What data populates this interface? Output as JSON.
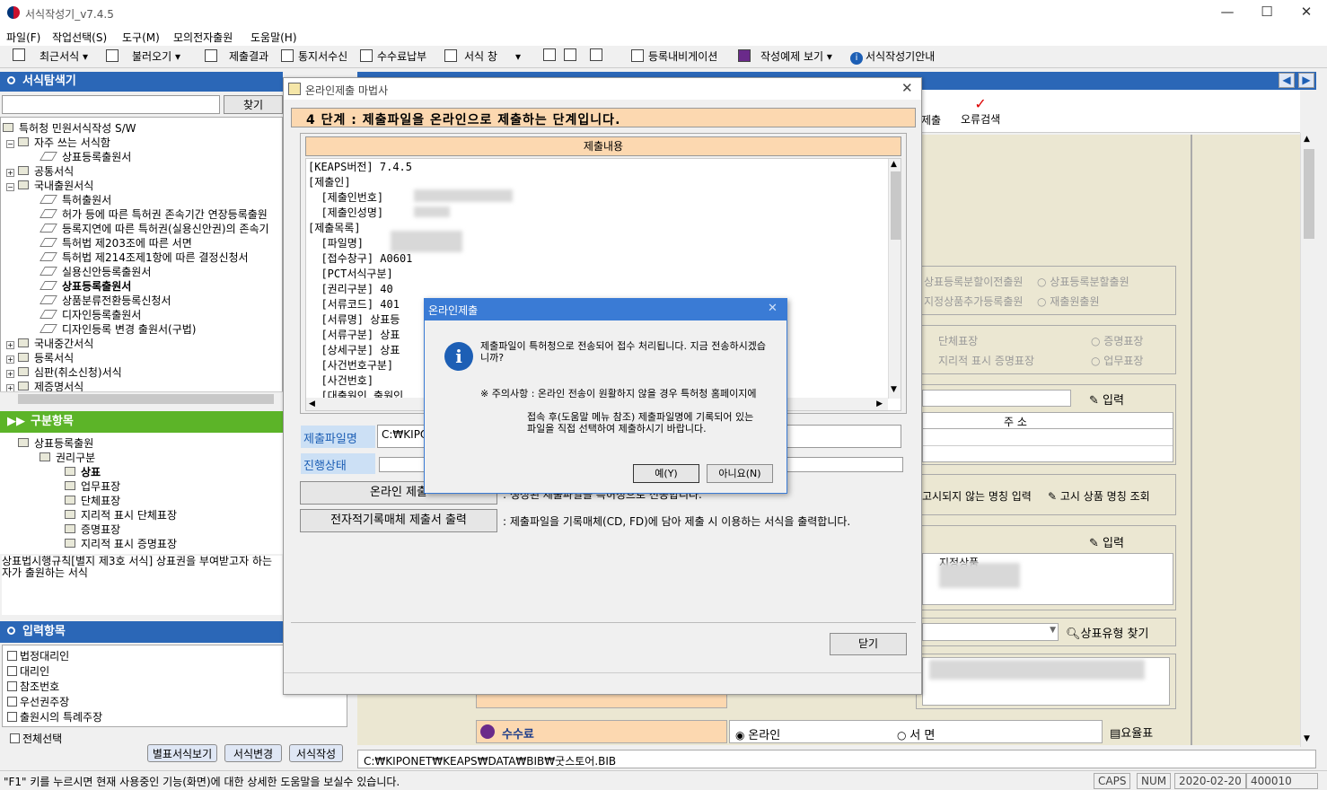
{
  "app": {
    "title": "서식작성기_v7.4.5"
  },
  "menu": [
    "파일(F)",
    "작업선택(S)",
    "도구(M)",
    "모의전자출원",
    "도움말(H)"
  ],
  "toolbar": {
    "recent": "최근서식",
    "load": "불러오기",
    "result": "제출결과",
    "notice": "통지서수신",
    "fee": "수수료납부",
    "window": "서식 창",
    "navigation": "등록내비게이션",
    "example": "작성예제 보기",
    "guide": "서식작성기안내"
  },
  "explorer": {
    "header": "서식탐색기",
    "find_button": "찾기",
    "tree": [
      {
        "label": "특허청 민원서식작성 S/W",
        "level": 0
      },
      {
        "label": "자주 쓰는 서식함",
        "level": 1
      },
      {
        "label": "상표등록출원서",
        "level": 2
      },
      {
        "label": "공통서식",
        "level": 1
      },
      {
        "label": "국내출원서식",
        "level": 1
      },
      {
        "label": "특허출원서",
        "level": 2
      },
      {
        "label": "허가 등에 따른 특허권 존속기간 연장등록출원",
        "level": 2
      },
      {
        "label": "등록지연에 따른 특허권(실용신안권)의 존속기",
        "level": 2
      },
      {
        "label": "특허법 제203조에 따른 서면",
        "level": 2
      },
      {
        "label": "특허법 제214조제1항에 따른 결정신청서",
        "level": 2
      },
      {
        "label": "실용신안등록출원서",
        "level": 2
      },
      {
        "label": "상표등록출원서",
        "level": 2,
        "bold": true
      },
      {
        "label": "상품분류전환등록신청서",
        "level": 2
      },
      {
        "label": "디자인등록출원서",
        "level": 2
      },
      {
        "label": "디자인등록 변경 출원서(구법)",
        "level": 2
      },
      {
        "label": "국내중간서식",
        "level": 1
      },
      {
        "label": "등록서식",
        "level": 1
      },
      {
        "label": "심판(취소신청)서식",
        "level": 1
      },
      {
        "label": "제증명서식",
        "level": 1
      }
    ]
  },
  "category": {
    "header": "구분항목",
    "root": "상표등록출원",
    "sub": "권리구분",
    "items": [
      "상표",
      "업무표장",
      "단체표장",
      "지리적 표시 단체표장",
      "증명표장",
      "지리적 표시 증명표장"
    ],
    "description": "상표법시행규칙[별지 제3호 서식] 상표권을 부여받고자 하는 자가 출원하는 서식"
  },
  "input_items": {
    "header": "입력항목",
    "items": [
      "법정대리인",
      "대리인",
      "참조번호",
      "우선권주장",
      "출원시의 특례주장"
    ],
    "select_all": "전체선택",
    "btn_separate": "별표서식보기",
    "btn_change": "서식변경",
    "btn_write": "서식작성"
  },
  "right": {
    "submit_tab": "제출",
    "error_check": "오류검색",
    "opt1": "상표등록분할이전출원",
    "opt1a": "상표등록분할출원",
    "opt2": "지정상품추가등록출원",
    "opt2a": "재출원출원",
    "opt3": "단체표장",
    "opt3a": "증명표장",
    "opt4": "지리적 표시 증명표장",
    "opt4a": "업무표장",
    "input": "입력",
    "address": "주    소",
    "unlisted": "고시되지 않는 명칭 입력",
    "lookup": "고시 상품 명칭 조회",
    "input2": "입력",
    "designated": "지정상품",
    "type_search": "상표유형 찾기",
    "fee": "수수료",
    "online": "온라인",
    "paper": "서   면",
    "fee_table": "요율표"
  },
  "wizard": {
    "title": "온라인제출 마법사",
    "step": "4 단계 : 제출파일을 온라인으로 제출하는 단계입니다.",
    "content_header": "제출내용",
    "lines": [
      "[KEAPS버전] 7.4.5",
      "[제출인]",
      "  [제출인번호]",
      "  [제출인성명]",
      "[제출목록]",
      "  [파일명]",
      "  [접수창구] A0601",
      "  [PCT서식구분]",
      "  [권리구분] 40",
      "  [서류코드] 401",
      "  [서류명] 상표등",
      "  [서류구분] 상표",
      "  [상세구분] 상표",
      "  [사건번호구분]",
      "  [사건번호]",
      "  [대출원인 출원인"
    ],
    "file_label": "제출파일명",
    "file_value": "C:₩KIPO",
    "status_label": "진행상태",
    "online_btn": "온라인 제출",
    "online_desc": ": 생성된 제출파일을 특허청으로 전송합니다.",
    "media_btn": "전자적기록매체 제출서 출력",
    "media_desc": ": 제출파일을 기록매체(CD, FD)에 담아 제출 시 이용하는 서식을 출력합니다.",
    "close_btn": "닫기"
  },
  "dialog": {
    "title": "온라인제출",
    "message1": "제출파일이 특허청으로 전송되어 접수 처리됩니다. 지금 전송하시겠습니까?",
    "message2": "※ 주의사항 : 온라인 전송이 원활하지 않을 경우 특허청 홈페이지에",
    "message3": "접속 후(도움말 메뉴 참조) 제출파일명에 기록되어 있는 파일을 직접 선택하여 제출하시기 바랍니다.",
    "yes": "예(Y)",
    "no": "아니요(N)"
  },
  "path": "C:₩KIPONET₩KEAPS₩DATA₩BIB₩굿스토어.BIB",
  "status": {
    "hint": "\"F1\" 키를 누르시면 현재 사용중인 기능(화면)에 대한 상세한 도움말을 보실수 있습니다.",
    "caps": "CAPS",
    "num": "NUM",
    "date": "2020-02-20",
    "code": "400010"
  }
}
